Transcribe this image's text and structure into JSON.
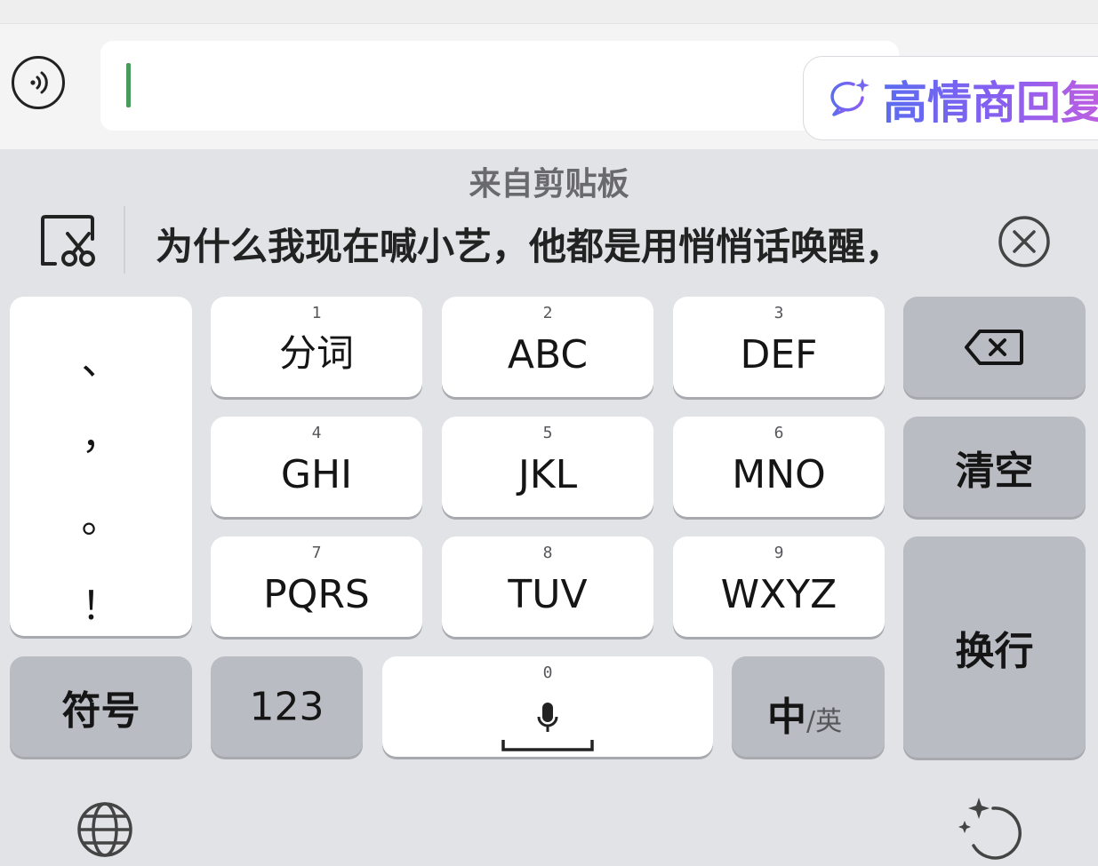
{
  "colors": {
    "keyboard_bg": "#e2e3e6",
    "key_white": "#ffffff",
    "key_function": "#babcc3",
    "caret": "#4a9a5a",
    "accent_gradient": [
      "#5a6cf0",
      "#c05fe0"
    ]
  },
  "input": {
    "value": "",
    "voice_icon": "voice-broadcast-icon"
  },
  "eq_reply": {
    "label": "高情商回复",
    "icon": "sparkle-chat-bubble-icon"
  },
  "clipboard": {
    "heading": "来自剪贴板",
    "text": "为什么我现在喊小艺，他都是用悄悄话唤醒，",
    "icon": "clipboard-scissors-icon",
    "close_icon": "close-circle-icon"
  },
  "keyboard": {
    "punctuation": [
      "、",
      "，",
      "。",
      "！"
    ],
    "digit_keys": [
      {
        "num": "1",
        "label": "分词"
      },
      {
        "num": "2",
        "label": "ABC"
      },
      {
        "num": "3",
        "label": "DEF"
      },
      {
        "num": "4",
        "label": "GHI"
      },
      {
        "num": "5",
        "label": "JKL"
      },
      {
        "num": "6",
        "label": "MNO"
      },
      {
        "num": "7",
        "label": "PQRS"
      },
      {
        "num": "8",
        "label": "TUV"
      },
      {
        "num": "9",
        "label": "WXYZ"
      }
    ],
    "backspace_icon": "backspace-icon",
    "clear_label": "清空",
    "enter_label": "换行",
    "symbol_label": "符号",
    "numeric_label": "123",
    "space": {
      "num": "0",
      "icon": "microphone-icon"
    },
    "lang": {
      "main": "中",
      "alt": "/英"
    }
  },
  "bottom_bar": {
    "left_icon": "globe-icon",
    "right_icon": "ai-sparkle-refresh-icon"
  }
}
